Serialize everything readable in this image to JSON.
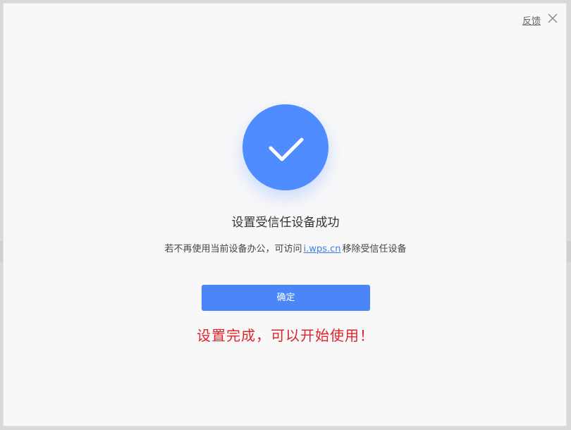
{
  "header": {
    "feedback_label": "反馈",
    "close_icon": "close-icon"
  },
  "status": {
    "icon": "checkmark-icon",
    "circle_color": "#4e8cff",
    "title": "设置受信任设备成功",
    "description_before": "若不再使用当前设备办公，可访问",
    "description_link": "i.wps.cn",
    "description_after": "移除受信任设备"
  },
  "actions": {
    "confirm_label": "确定",
    "confirm_color": "#4a86f7"
  },
  "annotation": {
    "text": "设置完成，可以开始使用！",
    "color": "#e0242a"
  }
}
